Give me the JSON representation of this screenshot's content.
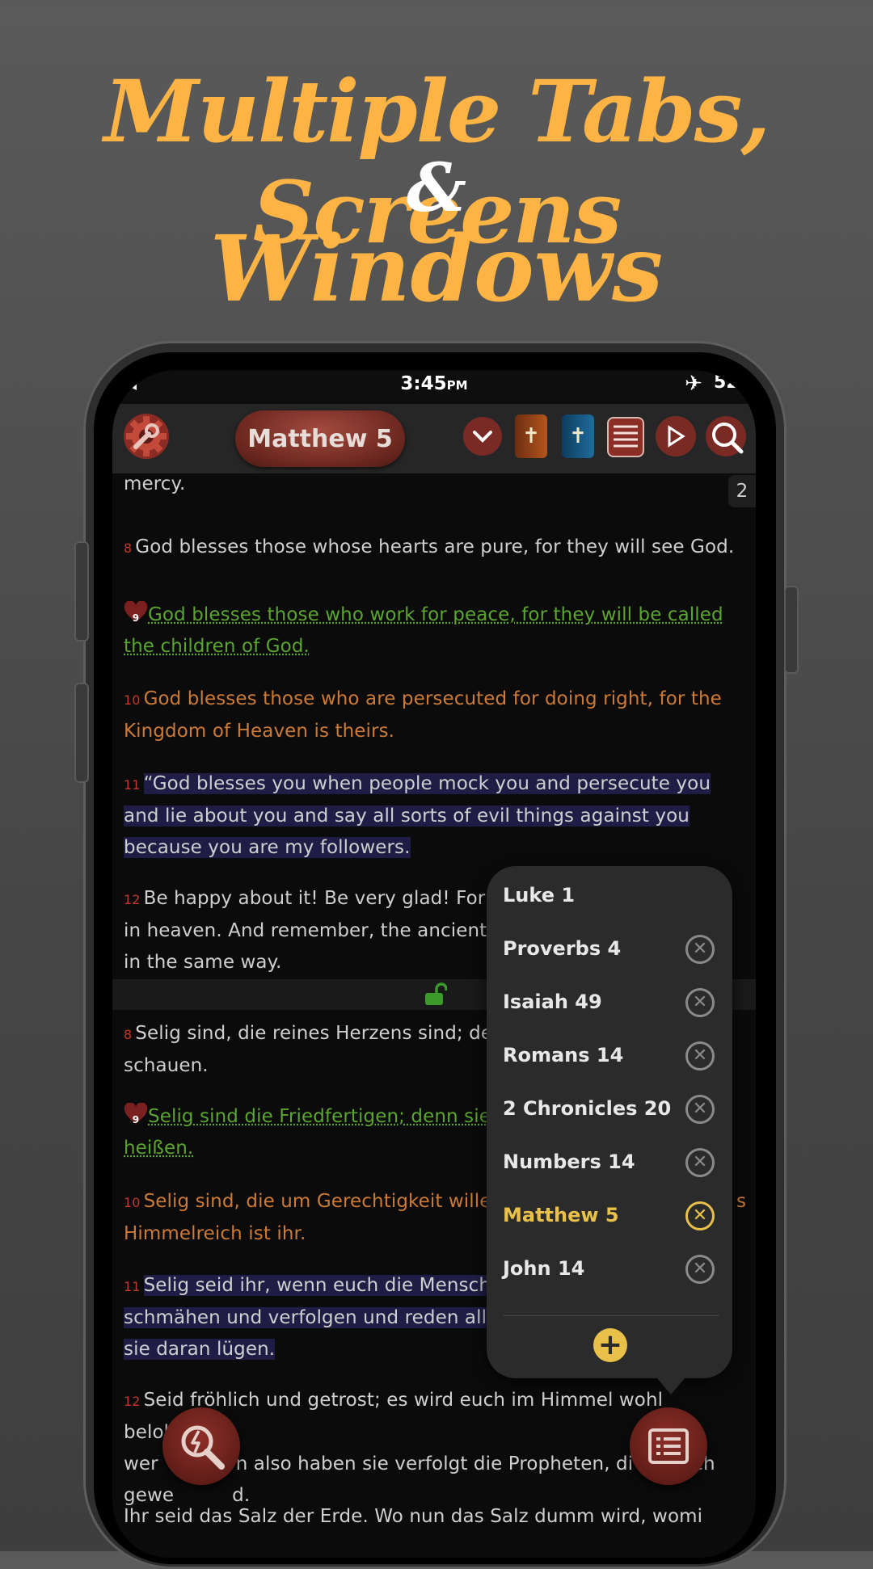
{
  "promo": {
    "line1": "Multiple Tabs, Screens",
    "line2": "&",
    "line3": "Windows"
  },
  "status_bar": {
    "time": "3:45",
    "ampm": "PM",
    "battery": "52",
    "left_icon": "notification-icon",
    "right_icon": "airplane-icon"
  },
  "toolbar": {
    "book_title": "Matthew 5",
    "buttons": [
      "settings-icon",
      "chevron-down-icon",
      "bible-brown-icon",
      "bible-blue-icon",
      "parallel-icon",
      "play-icon",
      "search-icon"
    ]
  },
  "page_counter": "2",
  "reader_top": {
    "frag": "mercy.",
    "v8_num": "8",
    "v8": "God blesses those whose hearts are pure, for they will see God.",
    "v9_num": "9",
    "v9": "God blesses those who work for peace, for they will be called the children of God.",
    "v10_num": "10",
    "v10": "God blesses those who are persecuted for doing right, for the Kingdom of Heaven is theirs.",
    "v11_num": "11",
    "v11": "“God blesses you when people mock you and persecute you and lie about you and say all sorts of evil things against you because you are my followers.",
    "v12_num": "12",
    "v12": "Be happy about it! Be very glad! For",
    "v12b": "in heaven. And remember, the ancient p",
    "v12c": "in the same way."
  },
  "reader_bottom": {
    "v8_num": "8",
    "v8a": "Selig sind, die reines Herzens sind; de",
    "v8b": "schauen.",
    "v9_num": "9",
    "v9a": "Selig sind die Friedfertigen; denn sie",
    "v9b": "heißen.",
    "v10_num": "10",
    "v10a": "Selig sind, die um Gerechtigkeit willen",
    "v10a_tail": "s",
    "v10b": "Himmelreich ist ihr.",
    "v11_num": "11",
    "v11a": "Selig seid ihr, wenn euch die Mensche",
    "v11b": "schmähen und verfolgen und reden alle",
    "v11c": "sie daran lügen.",
    "v12_num": "12",
    "v12a": "Seid fröhlich und getrost; es wird euch im Himmel wohl belohnt",
    "v12b_1": "wer",
    "v12b_2": "n also haben sie verfolgt die Propheten, di",
    "v12b_3": "ch",
    "v12c_1": "gewe",
    "v12c_2": "d.",
    "v13": "Ihr seid das Salz der Erde. Wo nun das Salz dumm wird, womi"
  },
  "tabs_popup": {
    "tabs": [
      {
        "label": "Luke 1",
        "closable": false,
        "active": false
      },
      {
        "label": "Proverbs 4",
        "closable": true,
        "active": false
      },
      {
        "label": "Isaiah 49",
        "closable": true,
        "active": false
      },
      {
        "label": "Romans 14",
        "closable": true,
        "active": false
      },
      {
        "label": "2 Chronicles 20",
        "closable": true,
        "active": false
      },
      {
        "label": "Numbers 14",
        "closable": true,
        "active": false
      },
      {
        "label": "Matthew 5",
        "closable": true,
        "active": true
      },
      {
        "label": "John 14",
        "closable": true,
        "active": false
      }
    ],
    "close_glyph": "✕",
    "add_glyph": "+"
  },
  "colors": {
    "headline": "#fdb444",
    "accent_red": "#7a2a24",
    "active_tab": "#e8c04a",
    "verse_green": "#5aa52f",
    "verse_orange": "#cc7a35",
    "highlight_blue": "#1f1d45"
  }
}
